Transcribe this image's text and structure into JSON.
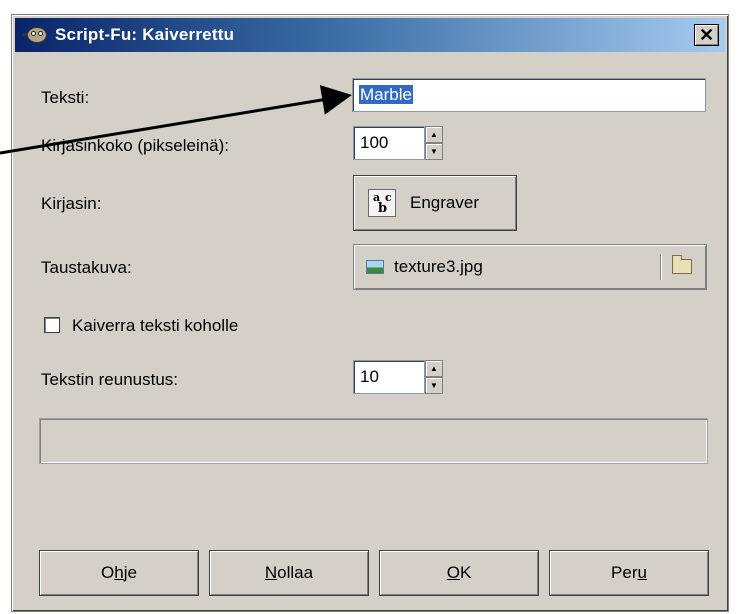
{
  "window": {
    "title": "Script-Fu: Kaiverrettu",
    "close_label": "✕"
  },
  "fields": {
    "text": {
      "label": "Teksti:",
      "value": "Marble"
    },
    "font_size": {
      "label": "Kirjasinkoko (pikseleinä):",
      "value": "100"
    },
    "font": {
      "label": "Kirjasin:",
      "value": "Engraver",
      "icon_glyphs": {
        "a": "a",
        "c": "c",
        "b": "b"
      }
    },
    "background": {
      "label": "Taustakuva:",
      "value": "texture3.jpg"
    },
    "engrave_raised": {
      "label": "Kaiverra teksti koholle",
      "checked": false
    },
    "text_border": {
      "label": "Tekstin reunustus:",
      "value": "10"
    }
  },
  "buttons": {
    "help": {
      "pre": "O",
      "mnemonic": "h",
      "post": "je"
    },
    "reset": {
      "pre": "",
      "mnemonic": "N",
      "post": "ollaa"
    },
    "ok": {
      "pre": "",
      "mnemonic": "O",
      "post": "K"
    },
    "cancel": {
      "pre": "Per",
      "mnemonic": "u",
      "post": ""
    }
  },
  "icons": {
    "window": "gimp-icon",
    "image_file": "image-icon",
    "folder": "folder-icon",
    "font": "font-icon"
  },
  "colors": {
    "dialog_bg": "#d4d0c8",
    "titlebar_start": "#0a246a",
    "titlebar_end": "#a6caf0",
    "selection": "#316ac5"
  }
}
